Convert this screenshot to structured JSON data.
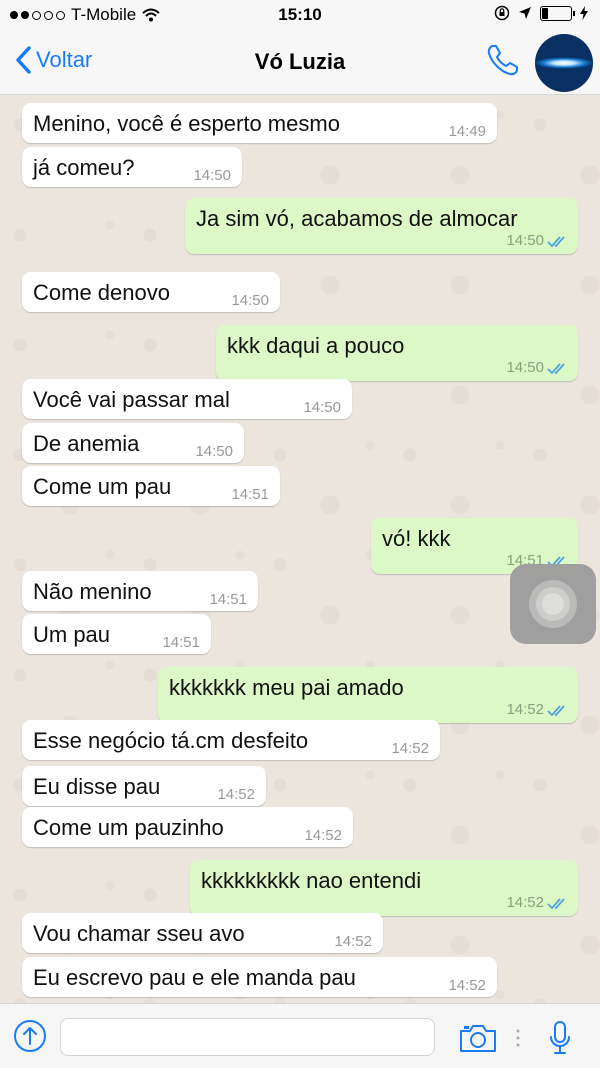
{
  "status_bar": {
    "carrier": "T-Mobile",
    "time": "15:10",
    "signal_bars": 2,
    "signal_total": 5,
    "battery_level": 0.2
  },
  "header": {
    "back_label": "Voltar",
    "contact_name": "Vó Luzia"
  },
  "messages": [
    {
      "dir": "in",
      "text": "Menino, você é esperto mesmo",
      "time": "14:49"
    },
    {
      "dir": "in",
      "text": "já comeu?",
      "time": "14:50"
    },
    {
      "dir": "out",
      "text": "Ja sim vó, acabamos de almocar",
      "time": "14:50",
      "read": true
    },
    {
      "dir": "in",
      "text": "Come denovo",
      "time": "14:50"
    },
    {
      "dir": "out",
      "text": "kkk daqui a pouco",
      "time": "14:50",
      "read": true
    },
    {
      "dir": "in",
      "text": "Você vai passar mal",
      "time": "14:50"
    },
    {
      "dir": "in",
      "text": "De anemia",
      "time": "14:50"
    },
    {
      "dir": "in",
      "text": "Come um pau",
      "time": "14:51"
    },
    {
      "dir": "out",
      "text": "vó! kkk",
      "time": "14:51",
      "read": true
    },
    {
      "dir": "in",
      "text": "Não menino",
      "time": "14:51"
    },
    {
      "dir": "in",
      "text": "Um pau",
      "time": "14:51"
    },
    {
      "dir": "out",
      "text": "kkkkkkk meu pai amado",
      "time": "14:52",
      "read": true
    },
    {
      "dir": "in",
      "text": "Esse negócio tá.cm desfeito",
      "time": "14:52"
    },
    {
      "dir": "in",
      "text": "Eu disse pau",
      "time": "14:52"
    },
    {
      "dir": "in",
      "text": "Come um pauzinho",
      "time": "14:52"
    },
    {
      "dir": "out",
      "text": "kkkkkkkkk nao entendi",
      "time": "14:52",
      "read": true
    },
    {
      "dir": "in",
      "text": "Vou chamar sseu avo",
      "time": "14:52"
    },
    {
      "dir": "in",
      "text": "Eu escrevo pau e ele manda pau",
      "time": "14:52"
    }
  ],
  "composer": {
    "value": "",
    "placeholder": ""
  },
  "icons": {
    "back": "chevron-left-icon",
    "call": "phone-icon",
    "upload": "upload-icon",
    "camera": "camera-icon",
    "mic": "microphone-icon",
    "assistive": "assistive-touch-icon"
  },
  "colors": {
    "accent": "#1a7cf5",
    "incoming_bubble": "#ffffff",
    "outgoing_bubble": "#dcf8c6",
    "read_ticks": "#4fa3e0",
    "chat_background": "#ece5dd"
  }
}
